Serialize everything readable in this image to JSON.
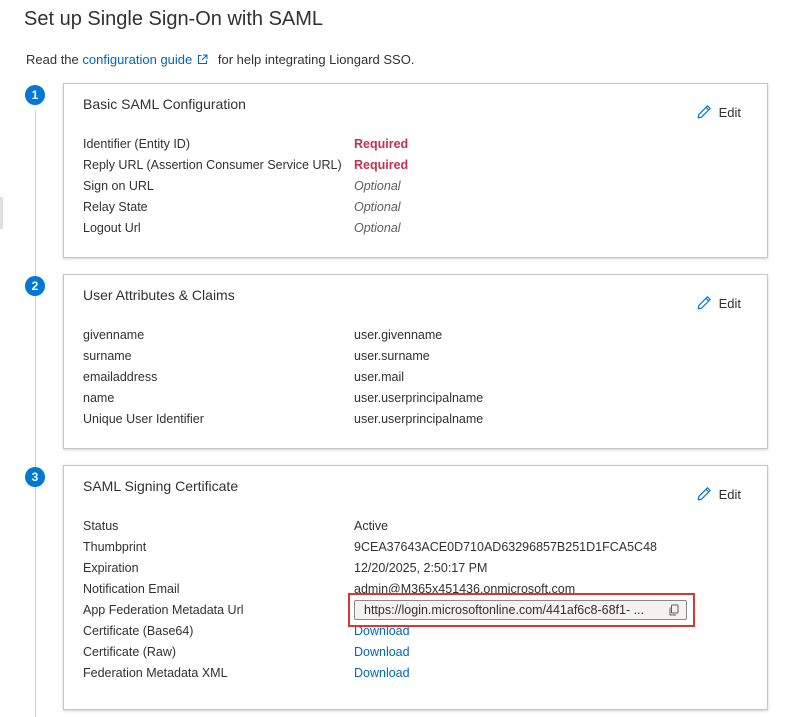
{
  "page": {
    "title": "Set up Single Sign-On with SAML",
    "intro_before": "Read the",
    "intro_link": "configuration guide",
    "intro_after": "for help integrating Liongard SSO."
  },
  "sections": [
    {
      "step": "1",
      "title": "Basic SAML Configuration",
      "edit_label": "Edit",
      "rows": [
        {
          "label": "Identifier (Entity ID)",
          "value": "Required"
        },
        {
          "label": "Reply URL (Assertion Consumer Service URL)",
          "value": "Required"
        },
        {
          "label": "Sign on URL",
          "value": "Optional"
        },
        {
          "label": "Relay State",
          "value": "Optional"
        },
        {
          "label": "Logout Url",
          "value": "Optional"
        }
      ]
    },
    {
      "step": "2",
      "title": "User Attributes & Claims",
      "edit_label": "Edit",
      "rows": [
        {
          "label": "givenname",
          "value": "user.givenname"
        },
        {
          "label": "surname",
          "value": "user.surname"
        },
        {
          "label": "emailaddress",
          "value": "user.mail"
        },
        {
          "label": "name",
          "value": "user.userprincipalname"
        },
        {
          "label": "Unique User Identifier",
          "value": "user.userprincipalname"
        }
      ]
    },
    {
      "step": "3",
      "title": "SAML Signing Certificate",
      "edit_label": "Edit",
      "rows": [
        {
          "label": "Status",
          "value": "Active"
        },
        {
          "label": "Thumbprint",
          "value": "9CEA37643ACE0D710AD63296857B251D1FCA5C48"
        },
        {
          "label": "Expiration",
          "value": "12/20/2025, 2:50:17 PM"
        },
        {
          "label": "Notification Email",
          "value": "admin@M365x451436.onmicrosoft.com"
        },
        {
          "label": "App Federation Metadata Url",
          "value": "https://login.microsoftonline.com/441af6c8-68f1- ..."
        },
        {
          "label": "Certificate (Base64)",
          "value": "Download"
        },
        {
          "label": "Certificate (Raw)",
          "value": "Download"
        },
        {
          "label": "Federation Metadata XML",
          "value": "Download"
        }
      ]
    }
  ],
  "colors": {
    "accent": "#0078d4",
    "link": "#0067b8",
    "required": "#c4314b",
    "highlight": "#d9372f"
  },
  "icons": {
    "external_link": "external-link-icon",
    "edit": "pencil-icon",
    "copy": "copy-icon"
  }
}
